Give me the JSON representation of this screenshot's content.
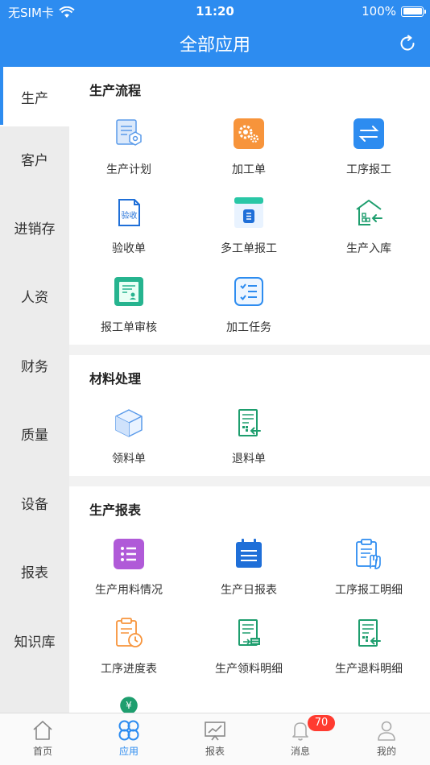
{
  "status": {
    "carrier": "无SIM卡",
    "time": "11:20",
    "battery": "100%"
  },
  "header": {
    "title": "全部应用"
  },
  "sidebar": {
    "items": [
      {
        "label": "生产"
      },
      {
        "label": "客户"
      },
      {
        "label": "进销存"
      },
      {
        "label": "人资"
      },
      {
        "label": "财务"
      },
      {
        "label": "质量"
      },
      {
        "label": "设备"
      },
      {
        "label": "报表"
      },
      {
        "label": "知识库"
      }
    ]
  },
  "sections": [
    {
      "title": "生产流程",
      "items": [
        {
          "label": "生产计划",
          "icon": "plan-doc-icon"
        },
        {
          "label": "加工单",
          "icon": "gear-icon"
        },
        {
          "label": "工序报工",
          "icon": "exchange-arrows-icon"
        },
        {
          "label": "验收单",
          "icon": "acceptance-doc-icon"
        },
        {
          "label": "多工单报工",
          "icon": "multi-order-icon"
        },
        {
          "label": "生产入库",
          "icon": "warehouse-in-icon"
        },
        {
          "label": "报工单审核",
          "icon": "review-doc-icon"
        },
        {
          "label": "加工任务",
          "icon": "checklist-icon"
        }
      ]
    },
    {
      "title": "材料处理",
      "items": [
        {
          "label": "领料单",
          "icon": "box-icon"
        },
        {
          "label": "退料单",
          "icon": "return-doc-icon"
        }
      ]
    },
    {
      "title": "生产报表",
      "items": [
        {
          "label": "生产用料情况",
          "icon": "list-icon"
        },
        {
          "label": "生产日报表",
          "icon": "calendar-doc-icon"
        },
        {
          "label": "工序报工明细",
          "icon": "hand-clipboard-icon"
        },
        {
          "label": "工序进度表",
          "icon": "clipboard-clock-icon"
        },
        {
          "label": "生产领料明细",
          "icon": "material-receive-icon"
        },
        {
          "label": "生产退料明细",
          "icon": "material-return-icon"
        }
      ]
    }
  ],
  "tabbar": {
    "items": [
      {
        "label": "首页",
        "icon": "home-icon"
      },
      {
        "label": "应用",
        "icon": "apps-icon"
      },
      {
        "label": "报表",
        "icon": "chart-board-icon"
      },
      {
        "label": "消息",
        "icon": "bell-icon"
      },
      {
        "label": "我的",
        "icon": "user-icon"
      }
    ],
    "message_badge": "70"
  },
  "colors": {
    "primary": "#2d8cf0",
    "orange": "#f7943b",
    "green": "#1e9e6e",
    "purple": "#b05ad8"
  }
}
